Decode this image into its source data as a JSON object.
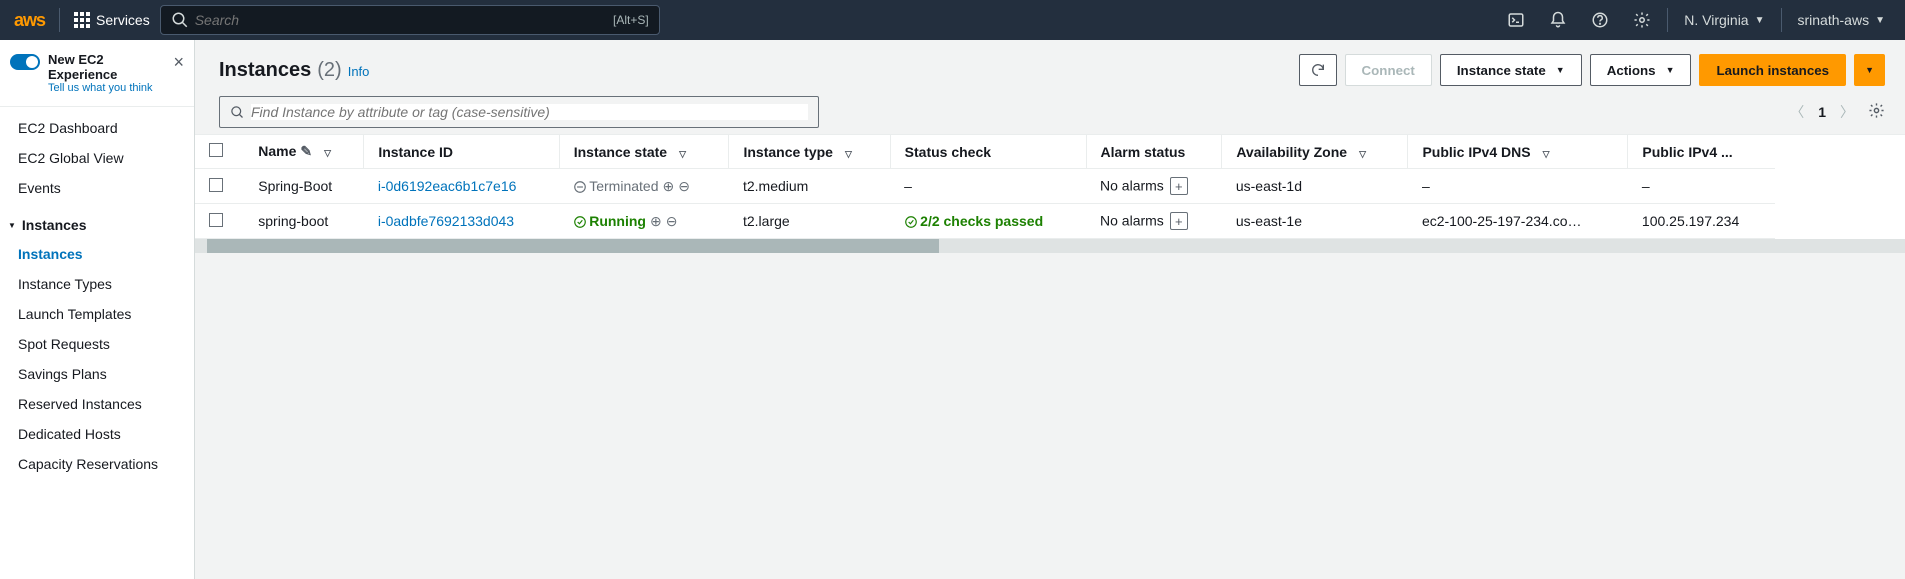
{
  "topbar": {
    "logo": "aws",
    "services": "Services",
    "search_placeholder": "Search",
    "shortcut": "[Alt+S]",
    "region": "N. Virginia",
    "user": "srinath-aws"
  },
  "sidebar": {
    "experience_title": "New EC2 Experience",
    "experience_sub": "Tell us what you think",
    "top_items": [
      "EC2 Dashboard",
      "EC2 Global View",
      "Events"
    ],
    "section": "Instances",
    "items": [
      "Instances",
      "Instance Types",
      "Launch Templates",
      "Spot Requests",
      "Savings Plans",
      "Reserved Instances",
      "Dedicated Hosts",
      "Capacity Reservations"
    ]
  },
  "header": {
    "title": "Instances",
    "count": "(2)",
    "info": "Info",
    "filter_placeholder": "Find Instance by attribute or tag (case-sensitive)",
    "page": "1",
    "btn_connect": "Connect",
    "btn_state": "Instance state",
    "btn_actions": "Actions",
    "btn_launch": "Launch instances"
  },
  "columns": {
    "name": "Name",
    "id": "Instance ID",
    "state": "Instance state",
    "type": "Instance type",
    "status": "Status check",
    "alarm": "Alarm status",
    "az": "Availability Zone",
    "dns": "Public IPv4 DNS",
    "ip": "Public IPv4 ..."
  },
  "rows": [
    {
      "name": "Spring-Boot",
      "id": "i-0d6192eac6b1c7e16",
      "state": "Terminated",
      "state_kind": "term",
      "type": "t2.medium",
      "status": "–",
      "alarm": "No alarms",
      "az": "us-east-1d",
      "dns": "–",
      "ip": "–"
    },
    {
      "name": "spring-boot",
      "id": "i-0adbfe7692133d043",
      "state": "Running",
      "state_kind": "run",
      "type": "t2.large",
      "status": "2/2 checks passed",
      "alarm": "No alarms",
      "az": "us-east-1e",
      "dns": "ec2-100-25-197-234.co…",
      "ip": "100.25.197.234"
    }
  ]
}
